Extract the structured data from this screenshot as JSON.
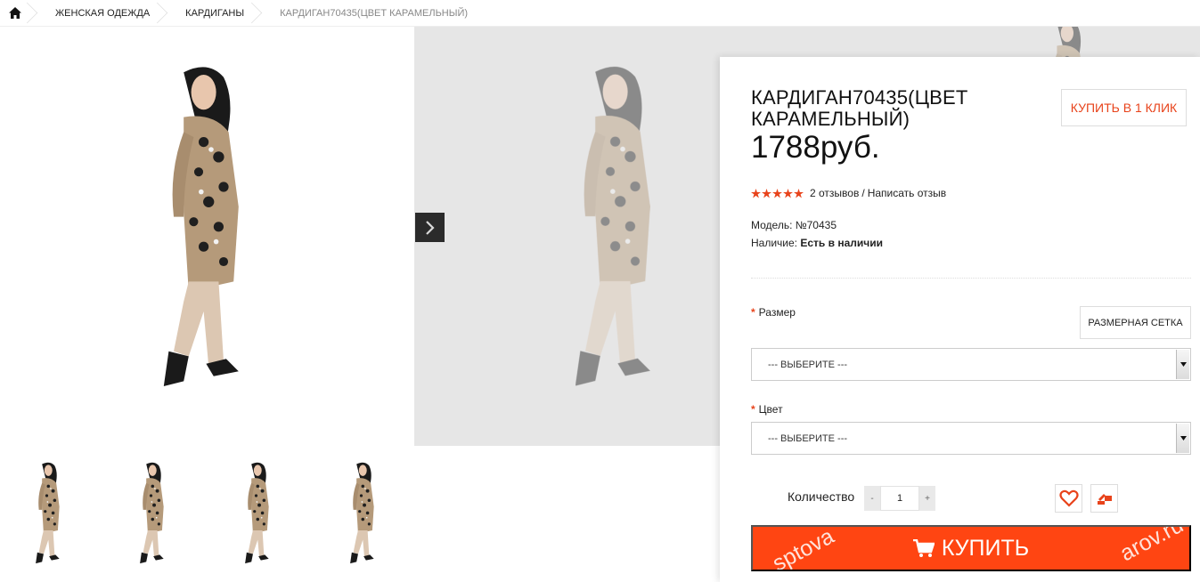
{
  "breadcrumb": {
    "home_icon": "home-icon",
    "items": [
      {
        "label": "ЖЕНСКАЯ ОДЕЖДА"
      },
      {
        "label": "КАРДИГАНЫ"
      },
      {
        "label": "КАРДИГАН70435(ЦВЕТ КАРАМЕЛЬНЫЙ)"
      }
    ]
  },
  "product": {
    "title": "КАРДИГАН70435(ЦВЕТ КАРАМЕЛЬНЫЙ)",
    "price": "1788руб.",
    "buy_one_click": "КУПИТЬ В 1 КЛИК",
    "rating": {
      "stars": 5,
      "reviews": "2 отзывов",
      "separator": "/",
      "write_review": "Написать отзыв"
    },
    "model_label": "Модель:",
    "model_value": "№70435",
    "availability_label": "Наличие:",
    "availability_value": "Есть в наличии"
  },
  "options": {
    "size": {
      "label": "Размер",
      "placeholder": "--- ВЫБЕРИТЕ ---",
      "size_chart_button": "РАЗМЕРНАЯ СЕТКА"
    },
    "color": {
      "label": "Цвет",
      "placeholder": "--- ВЫБЕРИТЕ ---"
    }
  },
  "quantity": {
    "label": "Количество",
    "value": "1",
    "minus": "-",
    "plus": "+"
  },
  "actions": {
    "wishlist_icon": "heart-icon",
    "compare_icon": "compare-icon",
    "buy_label": "КУПИТЬ",
    "cart_icon": "cart-icon"
  },
  "watermark": {
    "left_text": "sptova",
    "right_text": "arov.ru"
  },
  "gallery": {
    "next_icon": "chevron-right-icon",
    "thumbnails": [
      "thumbnail-1",
      "thumbnail-2",
      "thumbnail-3",
      "thumbnail-4"
    ]
  },
  "colors": {
    "accent": "#ff4512",
    "accent_text": "#e8431b",
    "star": "#e8431b",
    "cardigan": "#b59a7a",
    "pants": "#dcc7b2"
  }
}
